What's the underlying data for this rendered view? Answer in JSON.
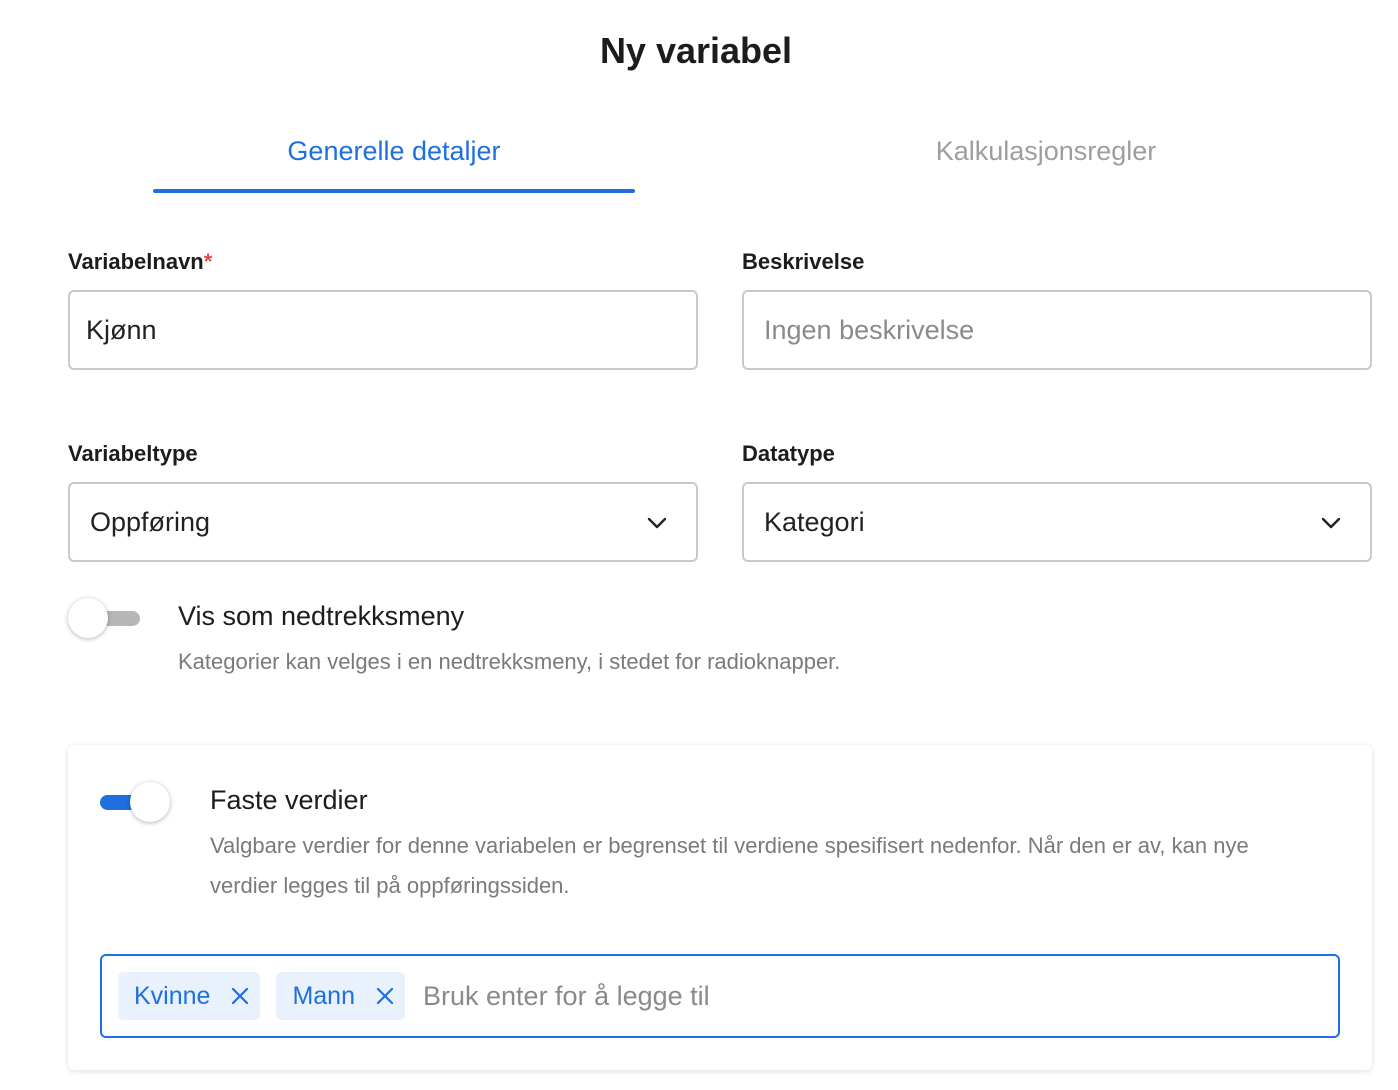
{
  "dialog": {
    "title": "Ny variabel"
  },
  "tabs": [
    {
      "label": "Generelle detaljer",
      "active": true
    },
    {
      "label": "Kalkulasjonsregler",
      "active": false
    }
  ],
  "form": {
    "name_label": "Variabelnavn",
    "name_required_mark": "*",
    "name_value": "Kjønn",
    "description_label": "Beskrivelse",
    "description_placeholder": "Ingen beskrivelse",
    "variable_type_label": "Variabeltype",
    "variable_type_value": "Oppføring",
    "data_type_label": "Datatype",
    "data_type_value": "Kategori"
  },
  "dropdown_toggle": {
    "enabled": false,
    "title": "Vis som nedtrekksmeny",
    "description": "Kategorier kan velges i en nedtrekksmeny, i stedet for radioknapper."
  },
  "fixed_values": {
    "enabled": true,
    "title": "Faste verdier",
    "description": "Valgbare verdier for denne variabelen er begrenset til verdiene spesifisert nedenfor. Når den er av, kan nye verdier legges til på oppføringssiden.",
    "tags": [
      {
        "label": "Kvinne"
      },
      {
        "label": "Mann"
      }
    ],
    "input_placeholder": "Bruk enter for å legge til"
  },
  "colors": {
    "accent": "#1f6fe0",
    "required": "#e5484d",
    "tag_bg": "#e8f1fc",
    "toggle_off": "#b7b7b7"
  },
  "icons": {
    "select_chevron": "chevron-down-icon",
    "tag_remove": "close-icon"
  }
}
